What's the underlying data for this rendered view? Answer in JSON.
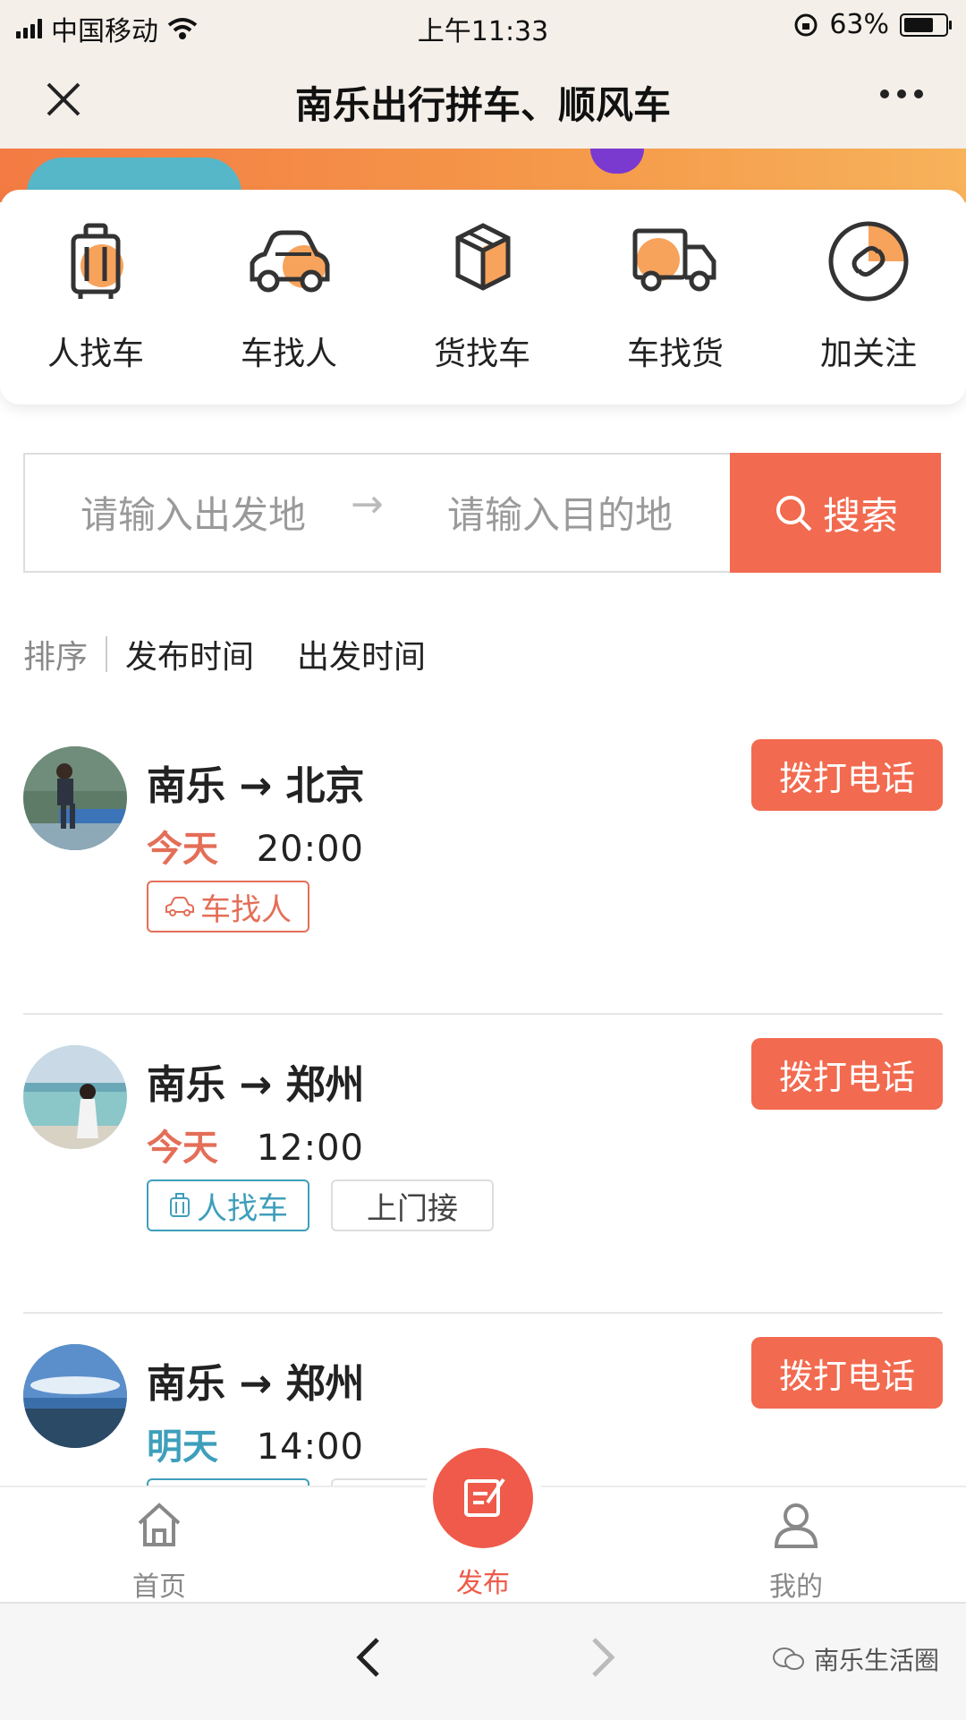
{
  "status_bar": {
    "carrier": "中国移动",
    "time": "上午11:33",
    "battery": "63%"
  },
  "nav": {
    "title": "南乐出行拼车、顺风车"
  },
  "quick_actions": [
    {
      "label": "人找车",
      "icon": "luggage-icon"
    },
    {
      "label": "车找人",
      "icon": "car-icon"
    },
    {
      "label": "货找车",
      "icon": "box-icon"
    },
    {
      "label": "车找货",
      "icon": "truck-icon"
    },
    {
      "label": "加关注",
      "icon": "follow-icon"
    }
  ],
  "search": {
    "from_placeholder": "请输入出发地",
    "arrow": "→",
    "to_placeholder": "请输入目的地",
    "button": "搜索"
  },
  "sort": {
    "label": "排序",
    "options": [
      "发布时间",
      "出发时间"
    ]
  },
  "rides": [
    {
      "route": "南乐 → 北京",
      "day": "今天",
      "time": "20:00",
      "call": "拨打电话",
      "tags": [
        "车找人"
      ]
    },
    {
      "route": "南乐 → 郑州",
      "day": "今天",
      "time": "12:00",
      "call": "拨打电话",
      "tags": [
        "人找车",
        "上门接"
      ]
    },
    {
      "route": "南乐 → 郑州",
      "day": "明天",
      "time": "14:00",
      "call": "拨打电话",
      "tags": []
    }
  ],
  "tabbar": {
    "home": "首页",
    "publish": "发布",
    "mine": "我的"
  },
  "watermark": "南乐生活圈",
  "colors": {
    "accent": "#f26a4f",
    "today": "#e46e58",
    "tomorrow": "#3e9fbb"
  }
}
